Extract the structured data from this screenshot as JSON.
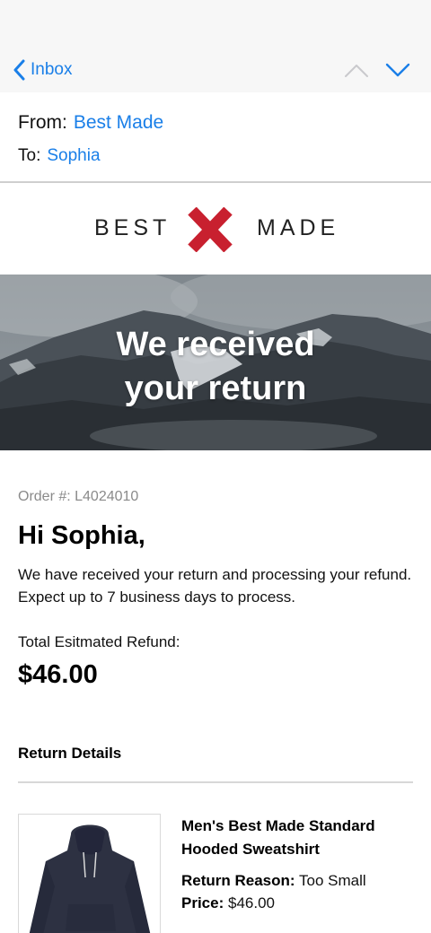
{
  "nav": {
    "back_label": "Inbox"
  },
  "header": {
    "from_key": "From:",
    "from_value": "Best Made",
    "to_key": "To:",
    "to_value": "Sophia"
  },
  "brand": {
    "left": "BEST",
    "right": "MADE",
    "x_color": "#c8202f"
  },
  "hero": {
    "line1": "We received",
    "line2": "your return"
  },
  "content": {
    "order_number": "Order #: L4024010",
    "greeting": "Hi Sophia,",
    "body": "We have received your return and processing your refund. Expect up to 7 business days to process.",
    "refund_label": "Total Esitmated Refund:",
    "refund_value": "$46.00",
    "section_title": "Return Details"
  },
  "product": {
    "name": "Men's Best Made Standard Hooded Sweatshirt",
    "reason_key": "Return Reason:",
    "reason_value": "Too Small",
    "price_key": "Price:",
    "price_value": "$46.00"
  },
  "colors": {
    "accent": "#1a7fe8",
    "nav_background": "#f7f7f7"
  }
}
